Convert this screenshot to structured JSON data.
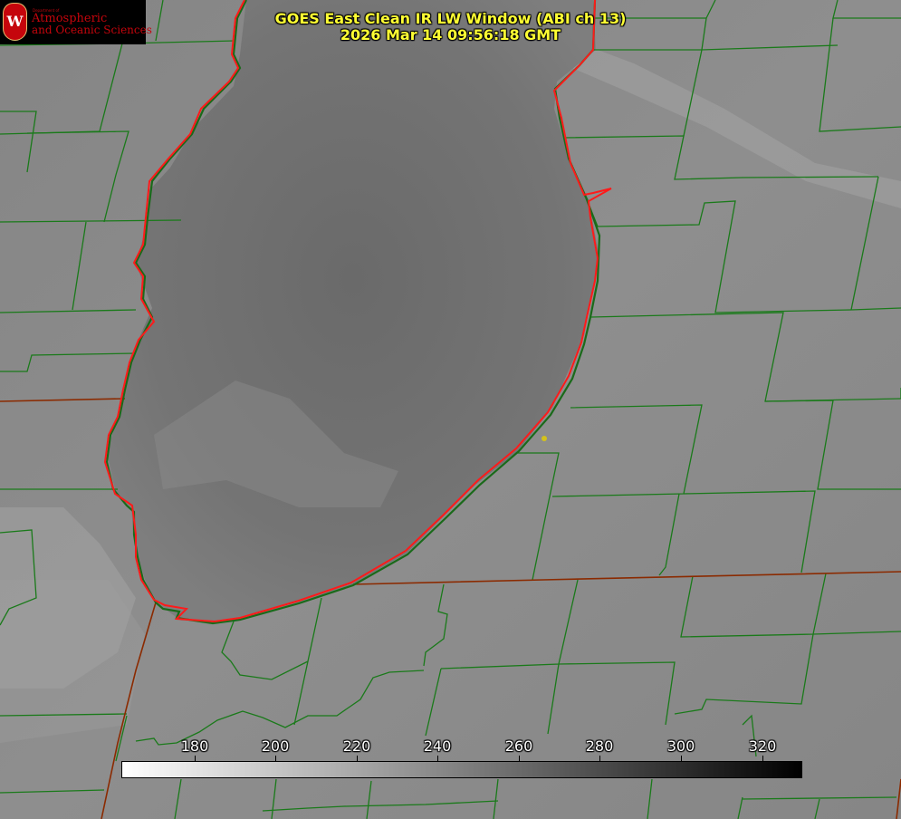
{
  "title": {
    "line1": "GOES East Clean IR LW Window (ABI ch 13)",
    "line2": "2026 Mar 14 09:56:18 GMT"
  },
  "logo": {
    "department": "Department of",
    "line1": "Atmospheric",
    "line2": "and Oceanic Sciences",
    "crest_letter": "W"
  },
  "colorbar": {
    "ticks": [
      "180",
      "200",
      "220",
      "240",
      "260",
      "280",
      "300",
      "320"
    ],
    "range": [
      162,
      332
    ],
    "gradient_start": "#ffffff",
    "gradient_end": "#000000"
  },
  "colors": {
    "county_lines": "#1a7a1a",
    "state_border": "#8b2a00",
    "lake_outline": "#ff1a1a",
    "station_dot": "#d4c21a",
    "background_gray": "#8c8c8c"
  }
}
